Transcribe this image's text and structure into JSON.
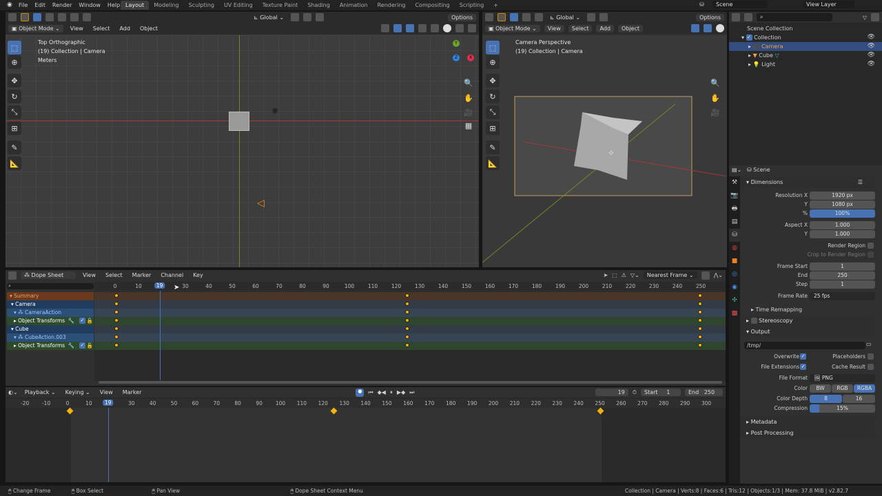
{
  "topbar": {
    "menus": [
      "File",
      "Edit",
      "Render",
      "Window",
      "Help"
    ],
    "workspaces": [
      "Layout",
      "Modeling",
      "Sculpting",
      "UV Editing",
      "Texture Paint",
      "Shading",
      "Animation",
      "Rendering",
      "Compositing",
      "Scripting"
    ],
    "active_workspace": "Layout",
    "scene": "Scene",
    "view_layer": "View Layer"
  },
  "viewport_left": {
    "orientation": "Global",
    "options": "Options",
    "mode": "Object Mode",
    "menus": [
      "View",
      "Select",
      "Add",
      "Object"
    ],
    "view_name": "Top Orthographic",
    "collection_info": "(19) Collection | Camera",
    "units": "Meters"
  },
  "viewport_right": {
    "orientation": "Global",
    "options": "Options",
    "mode": "Object Mode",
    "menus": [
      "View",
      "Select",
      "Add",
      "Object"
    ],
    "view_name": "Camera Perspective",
    "collection_info": "(19) Collection | Camera"
  },
  "gizmo": {
    "x": "X",
    "y": "Y",
    "z": "Z"
  },
  "outliner": {
    "root": "Scene Collection",
    "items": [
      {
        "name": "Collection",
        "level": 1
      },
      {
        "name": "Camera",
        "level": 2,
        "selected": true
      },
      {
        "name": "Cube",
        "level": 2
      },
      {
        "name": "Light",
        "level": 2
      }
    ]
  },
  "properties": {
    "context": "Scene",
    "dimensions": "Dimensions",
    "resolution_x_label": "Resolution X",
    "resolution_x": "1920 px",
    "y_label": "Y",
    "resolution_y": "1080 px",
    "pct_label": "%",
    "resolution_pct": "100%",
    "aspect_x_label": "Aspect X",
    "aspect_x": "1.000",
    "aspect_y": "1.000",
    "render_region": "Render Region",
    "crop": "Crop to Render Region",
    "frame_start_label": "Frame Start",
    "frame_start": "1",
    "end_label": "End",
    "frame_end": "250",
    "step_label": "Step",
    "step": "1",
    "frame_rate_label": "Frame Rate",
    "frame_rate": "25 fps",
    "time_remapping": "Time Remapping",
    "stereoscopy": "Stereoscopy",
    "output": "Output",
    "output_path": "/tmp/",
    "overwrite": "Overwrite",
    "placeholders": "Placeholders",
    "file_extensions": "File Extensions",
    "cache_result": "Cache Result",
    "file_format_label": "File Format",
    "file_format": "PNG",
    "color_label": "Color",
    "color_options": [
      "BW",
      "RGB",
      "RGBA"
    ],
    "color_selected": "RGBA",
    "color_depth_label": "Color Depth",
    "color_depth_options": [
      "8",
      "16"
    ],
    "color_depth_selected": "8",
    "compression_label": "Compression",
    "compression": "15%",
    "compression_value": 15,
    "metadata": "Metadata",
    "post_processing": "Post Processing"
  },
  "dopesheet": {
    "editor": "Dope Sheet",
    "menus": [
      "View",
      "Select",
      "Marker",
      "Channel",
      "Key"
    ],
    "snap": "Nearest Frame",
    "current_frame": 19,
    "ruler": {
      "start": 0,
      "end": 250,
      "step": 10
    },
    "channels": [
      {
        "name": "Summary",
        "type": "summary"
      },
      {
        "name": "Camera",
        "type": "object"
      },
      {
        "name": "CameraAction",
        "type": "action"
      },
      {
        "name": "Object Transforms",
        "type": "group"
      },
      {
        "name": "Cube",
        "type": "object"
      },
      {
        "name": "CubeAction.003",
        "type": "action"
      },
      {
        "name": "Object Transforms",
        "type": "group"
      }
    ],
    "keyframes": [
      1,
      125,
      250
    ]
  },
  "timeline": {
    "menus": [
      "Playback",
      "Keying",
      "View",
      "Marker"
    ],
    "current_frame": "19",
    "start_label": "Start",
    "start": "1",
    "end_label": "End",
    "end": "250",
    "ruler": {
      "start": -20,
      "end": 300,
      "step": 10
    },
    "keyframes": [
      1,
      125,
      250
    ]
  },
  "statusbar": {
    "hints": [
      "Change Frame",
      "Box Select",
      "Pan View",
      "Dope Sheet Context Menu"
    ],
    "info": "Collection | Camera | Verts:8 | Faces:6 | Tris:12 | Objects:1/3 | Mem: 37.8 MiB | v2.82.7"
  },
  "colors": {
    "accent": "#4772b3",
    "keyframe": "#f0b40a",
    "summary": "#6b3a1e",
    "object": "#1f3b5e",
    "action": "#2c4f78",
    "group": "#2d4a2a"
  }
}
